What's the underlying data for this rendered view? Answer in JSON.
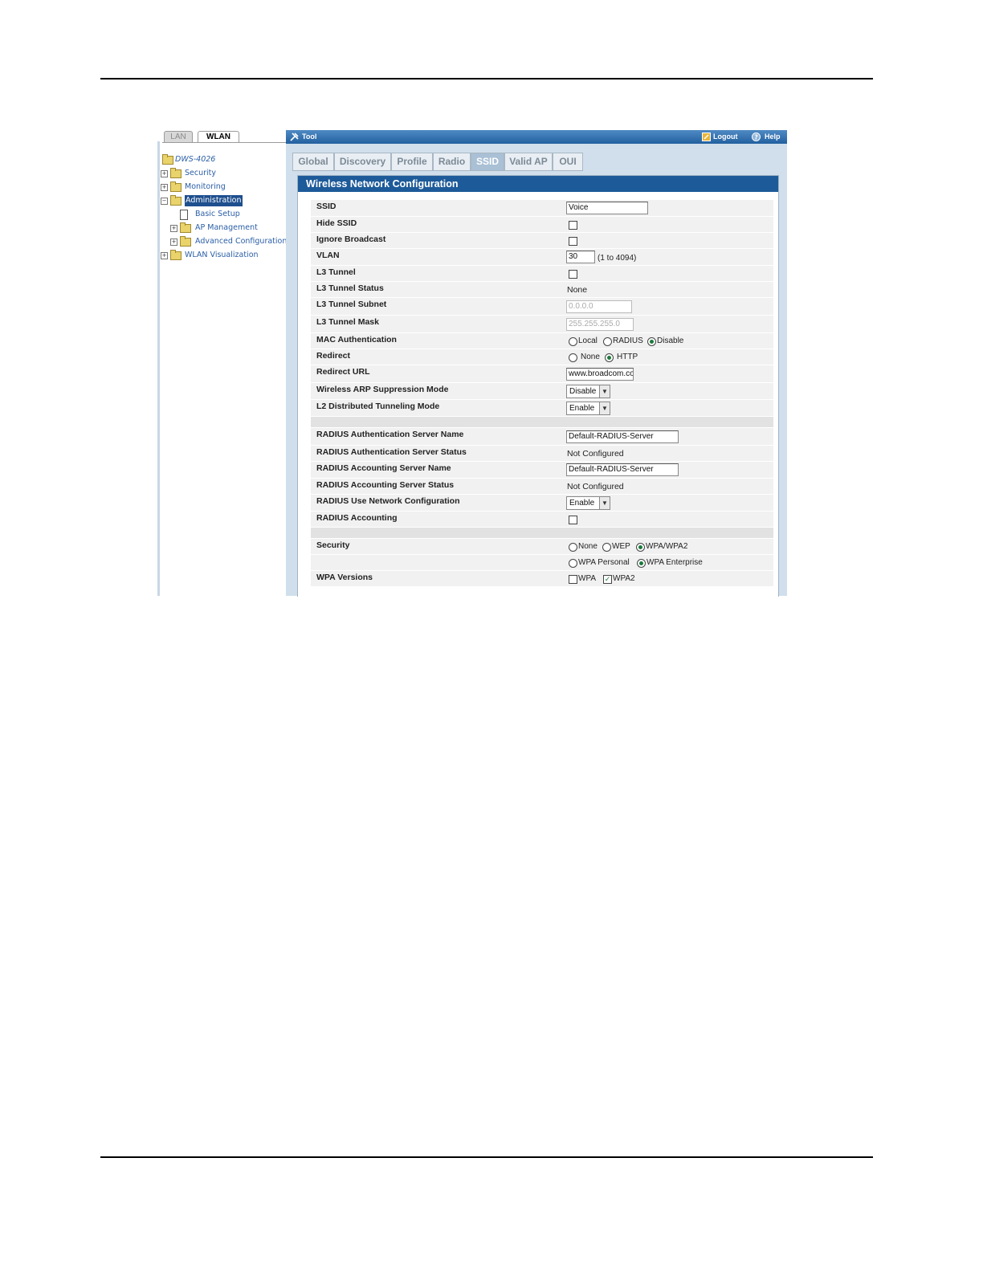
{
  "nav": {
    "tabs": [
      "LAN",
      "WLAN"
    ],
    "tree": {
      "root": "DWS-4026",
      "security": "Security",
      "monitoring": "Monitoring",
      "administration": "Administration",
      "basic_setup": "Basic Setup",
      "ap_management": "AP Management",
      "advanced_configuration": "Advanced Configuration",
      "wlan_visualization": "WLAN Visualization"
    }
  },
  "titlebar": {
    "tool": "Tool",
    "logout": "Logout",
    "help": "Help"
  },
  "tabs": [
    "Global",
    "Discovery",
    "Profile",
    "Radio",
    "SSID",
    "Valid AP",
    "OUI"
  ],
  "active_tab": "SSID",
  "form": {
    "title": "Wireless Network Configuration",
    "labels": {
      "ssid": "SSID",
      "hide_ssid": "Hide SSID",
      "ignore_broadcast": "Ignore Broadcast",
      "vlan": "VLAN",
      "l3_tunnel": "L3 Tunnel",
      "l3_tunnel_status": "L3 Tunnel Status",
      "l3_tunnel_subnet": "L3 Tunnel Subnet",
      "l3_tunnel_mask": "L3 Tunnel Mask",
      "mac_auth": "MAC Authentication",
      "redirect": "Redirect",
      "redirect_url": "Redirect URL",
      "arp_suppression": "Wireless ARP Suppression Mode",
      "l2_tunneling": "L2 Distributed Tunneling Mode",
      "radius_auth_name": "RADIUS Authentication Server Name",
      "radius_auth_status": "RADIUS Authentication Server Status",
      "radius_acct_name": "RADIUS Accounting Server Name",
      "radius_acct_status": "RADIUS Accounting Server Status",
      "radius_use_network": "RADIUS Use Network Configuration",
      "radius_accounting": "RADIUS Accounting",
      "security": "Security",
      "wpa_versions": "WPA Versions"
    },
    "values": {
      "ssid": "Voice",
      "vlan": "30",
      "vlan_range": "(1 to 4094)",
      "l3_tunnel_status": "None",
      "l3_tunnel_subnet": "0.0.0.0",
      "l3_tunnel_mask": "255.255.255.0",
      "redirect_url": "www.broadcom.co",
      "arp_suppression": "Disable",
      "l2_tunneling": "Enable",
      "radius_auth_name": "Default-RADIUS-Server",
      "radius_auth_status": "Not Configured",
      "radius_acct_name": "Default-RADIUS-Server",
      "radius_acct_status": "Not Configured",
      "radius_use_network": "Enable"
    },
    "options": {
      "mac_auth": [
        "Local",
        "RADIUS",
        "Disable"
      ],
      "redirect": [
        "None",
        "HTTP"
      ],
      "security": [
        "None",
        "WEP",
        "WPA/WPA2"
      ],
      "wpa_mode": [
        "WPA Personal",
        "WPA Enterprise"
      ],
      "wpa_versions": [
        "WPA",
        "WPA2"
      ]
    },
    "checked": {
      "hide_ssid": false,
      "ignore_broadcast": false,
      "l3_tunnel": false,
      "radius_accounting": false,
      "wpa": false,
      "wpa2": true
    },
    "selected": {
      "mac_auth": "Disable",
      "redirect": "HTTP",
      "security": "WPA/WPA2",
      "wpa_mode": "WPA Enterprise"
    }
  }
}
